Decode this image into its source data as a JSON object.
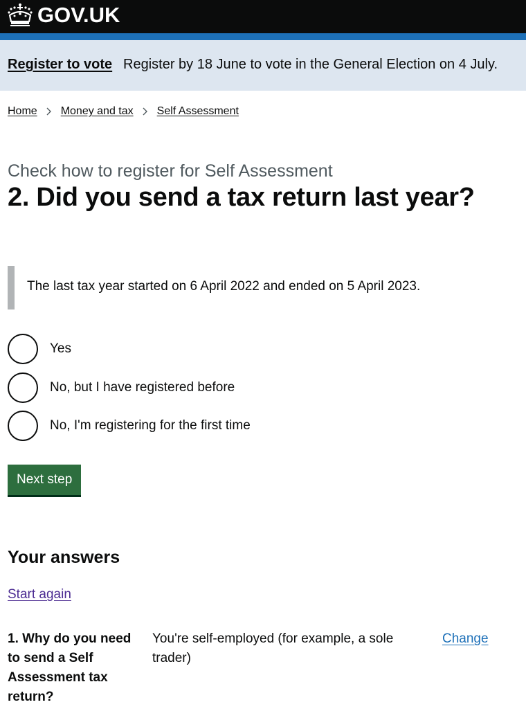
{
  "header": {
    "logo_text": "GOV.UK",
    "background": "#0b0c0c",
    "stripe_color": "#1d70b8"
  },
  "banner": {
    "link": "Register to vote",
    "text": "Register by 18 June to vote in the General Election on 4 July.",
    "background": "#dde6f0"
  },
  "breadcrumbs": [
    "Home",
    "Money and tax",
    "Self Assessment"
  ],
  "page": {
    "caption": "Check how to register for Self Assessment",
    "heading": "2. Did you send a tax return last year?",
    "inset_text": "The last tax year started on 6 April 2022 and ended on 5 April 2023."
  },
  "options": [
    "Yes",
    "No, but I have registered before",
    "No, I'm registering for the first time"
  ],
  "next_button": {
    "label": "Next step",
    "color": "#2d6e3e"
  },
  "answers": {
    "title": "Your answers",
    "start_again": "Start again",
    "rows": [
      {
        "question": "1. Why do you need to send a Self Assessment tax return?",
        "answer": "You're self-employed (for example, a sole trader)",
        "change": "Change"
      }
    ]
  }
}
